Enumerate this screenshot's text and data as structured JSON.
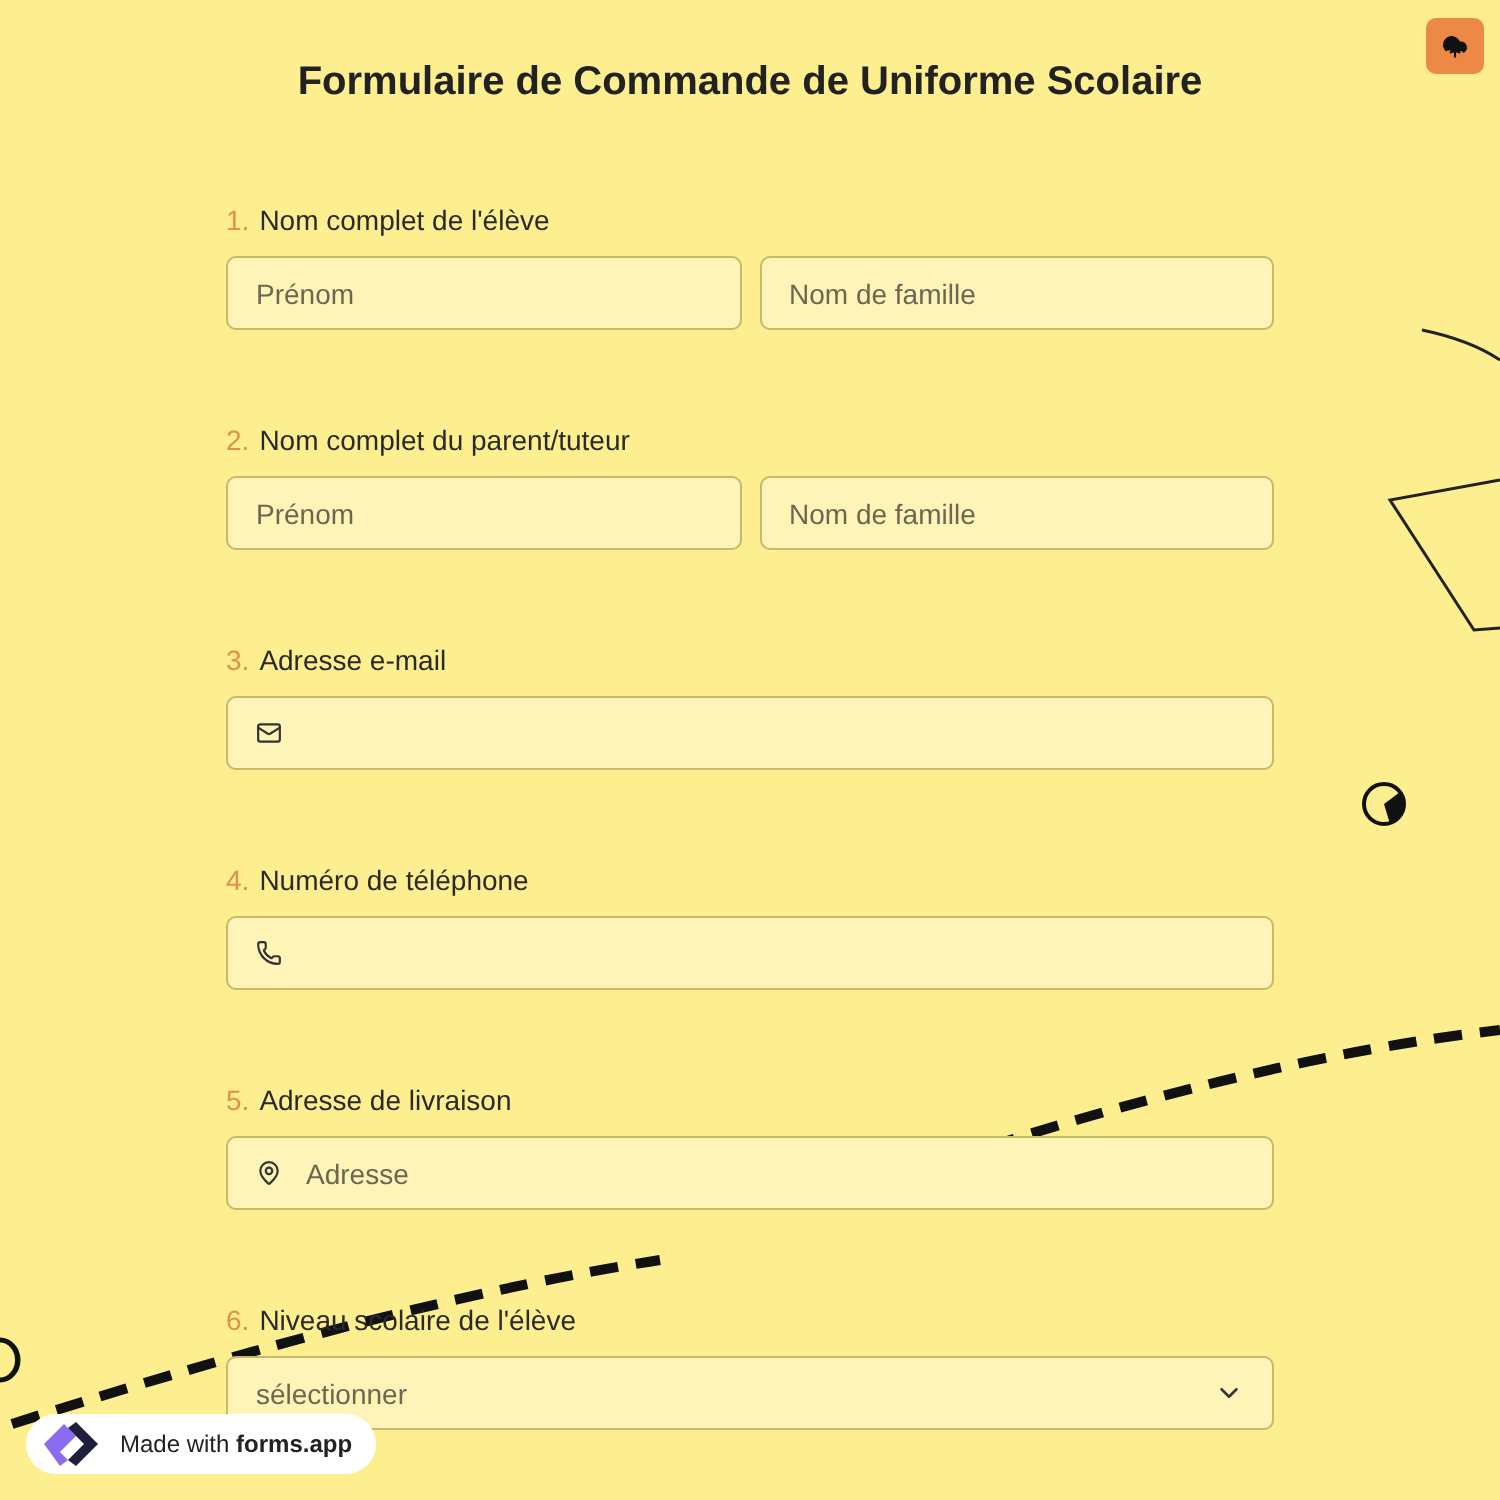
{
  "title": "Formulaire de Commande de Uniforme Scolaire",
  "questions": [
    {
      "number": "1.",
      "label": "Nom complet de l'élève",
      "kind": "name",
      "fields": [
        {
          "placeholder": "Prénom"
        },
        {
          "placeholder": "Nom de famille"
        }
      ]
    },
    {
      "number": "2.",
      "label": "Nom complet du parent/tuteur",
      "kind": "name",
      "fields": [
        {
          "placeholder": "Prénom"
        },
        {
          "placeholder": "Nom de famille"
        }
      ]
    },
    {
      "number": "3.",
      "label": "Adresse e-mail",
      "kind": "email"
    },
    {
      "number": "4.",
      "label": "Numéro de téléphone",
      "kind": "phone"
    },
    {
      "number": "5.",
      "label": "Adresse de livraison",
      "kind": "address",
      "fields": [
        {
          "placeholder": "Adresse"
        }
      ]
    },
    {
      "number": "6.",
      "label": "Niveau scolaire de l'élève",
      "kind": "select",
      "fields": [
        {
          "placeholder": "sélectionner"
        }
      ]
    }
  ],
  "badge": {
    "prefix": "Made with ",
    "brand": "forms.app"
  }
}
